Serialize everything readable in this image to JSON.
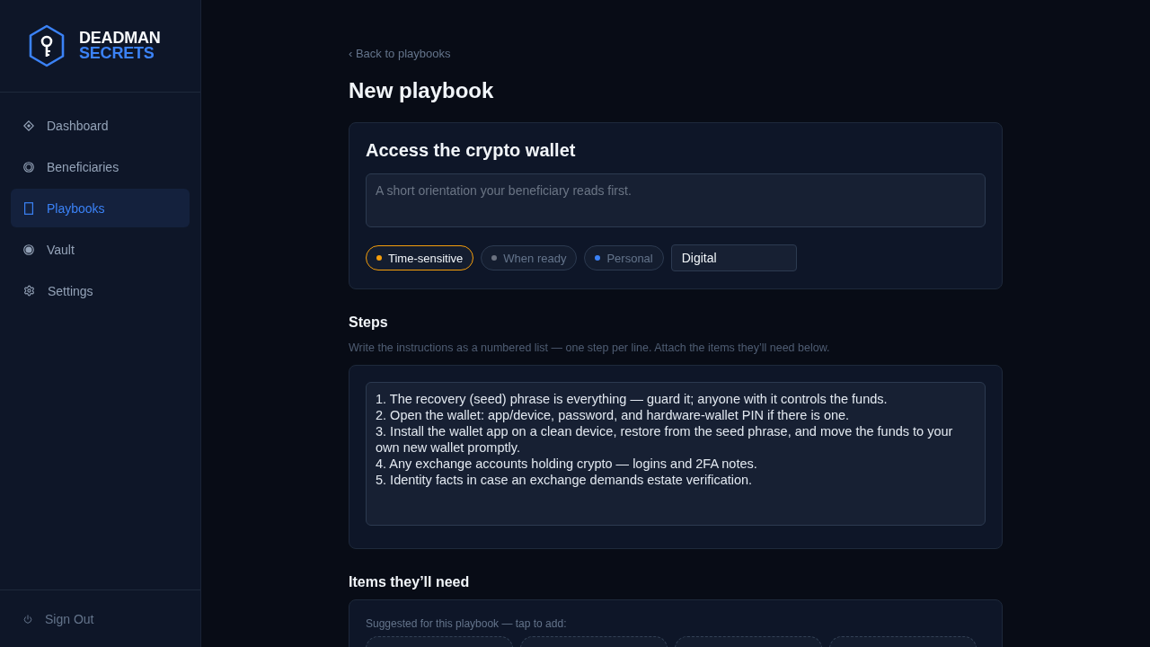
{
  "sidebar": {
    "brand": {
      "line_1": "DEADMAN",
      "line_2": "SECRETS"
    },
    "nav": [
      {
        "label": "Dashboard",
        "selected": false
      },
      {
        "label": "Beneficiaries",
        "selected": false
      },
      {
        "label": "Playbooks",
        "selected": true
      },
      {
        "label": "Vault",
        "selected": false
      },
      {
        "label": "Settings",
        "selected": false
      }
    ],
    "sign_out": "Sign Out"
  },
  "header": {
    "back_link": "‹ Back to playbooks",
    "title": "New playbook"
  },
  "playbook_card": {
    "title": "Access the crypto wallet",
    "summary": {
      "placeholder": "A short orientation your beneficiary reads first."
    },
    "tags": [
      {
        "label": "Time-sensitive",
        "color": "#f59e0b",
        "selected": true
      },
      {
        "label": "When ready",
        "color": "#6b7280",
        "selected": false
      },
      {
        "label": "Personal",
        "color": "#3b82f6",
        "selected": false
      }
    ],
    "category": {
      "value": "Digital"
    }
  },
  "steps": {
    "heading": "Steps",
    "hint": "Write the instructions as a numbered list — one step per line. Attach the items they’ll need below.",
    "value": "1. The recovery (seed) phrase is everything — guard it; anyone with it controls the funds.\n2. Open the wallet: app/device, password, and hardware-wallet PIN if there is one.\n3. Install the wallet app on a clean device, restore from the seed phrase, and move the funds to your own new wallet promptly.\n4. Any exchange accounts holding crypto — logins and 2FA notes.\n5. Identity facts in case an exchange demands estate verification."
  },
  "items": {
    "heading": "Items they’ll need",
    "suggestions_label": "Suggested for this playbook — tap to add:",
    "suggestions": [
      {
        "kind": "dashed"
      },
      {
        "kind": "dashed"
      },
      {
        "kind": "dashed"
      },
      {
        "kind": "dashed"
      }
    ]
  }
}
